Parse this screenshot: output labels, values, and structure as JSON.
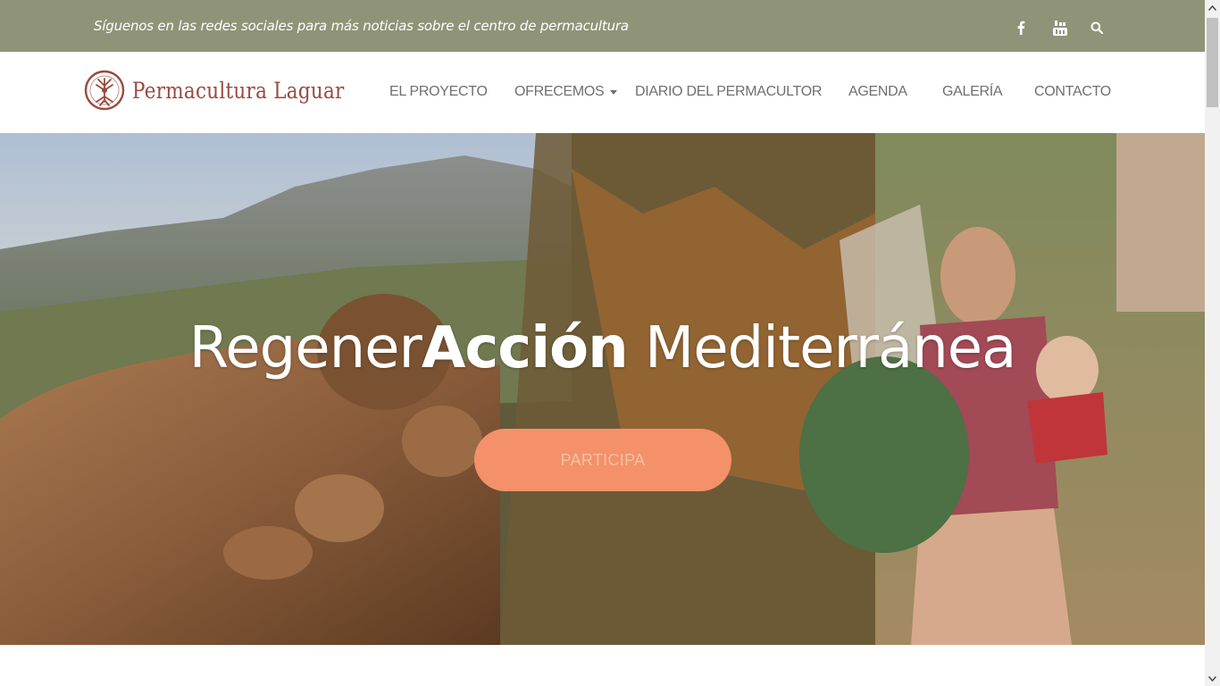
{
  "topbar": {
    "tagline": "Síguenos en las redes sociales para más noticias sobre el centro de permacultura",
    "icons": [
      "facebook-icon",
      "youtube-icon",
      "search-icon"
    ],
    "background": "#8f9478"
  },
  "header": {
    "logo_text": "Permacultura Laguar",
    "logo_color": "#9a4a3e",
    "nav": [
      {
        "label": "EL PROYECTO"
      },
      {
        "label": "OFRECEMOS"
      },
      {
        "label": "DIARIO DEL PERMACULTOR"
      },
      {
        "label": "AGENDA"
      },
      {
        "label": "GALERÍA"
      },
      {
        "label": "CONTACTO"
      }
    ]
  },
  "hero": {
    "title_part1": "Regener",
    "title_part2": "Acción",
    "title_part3": " Mediterránea",
    "cta_label": "PARTICIPA",
    "cta_color": "#f4916a"
  }
}
